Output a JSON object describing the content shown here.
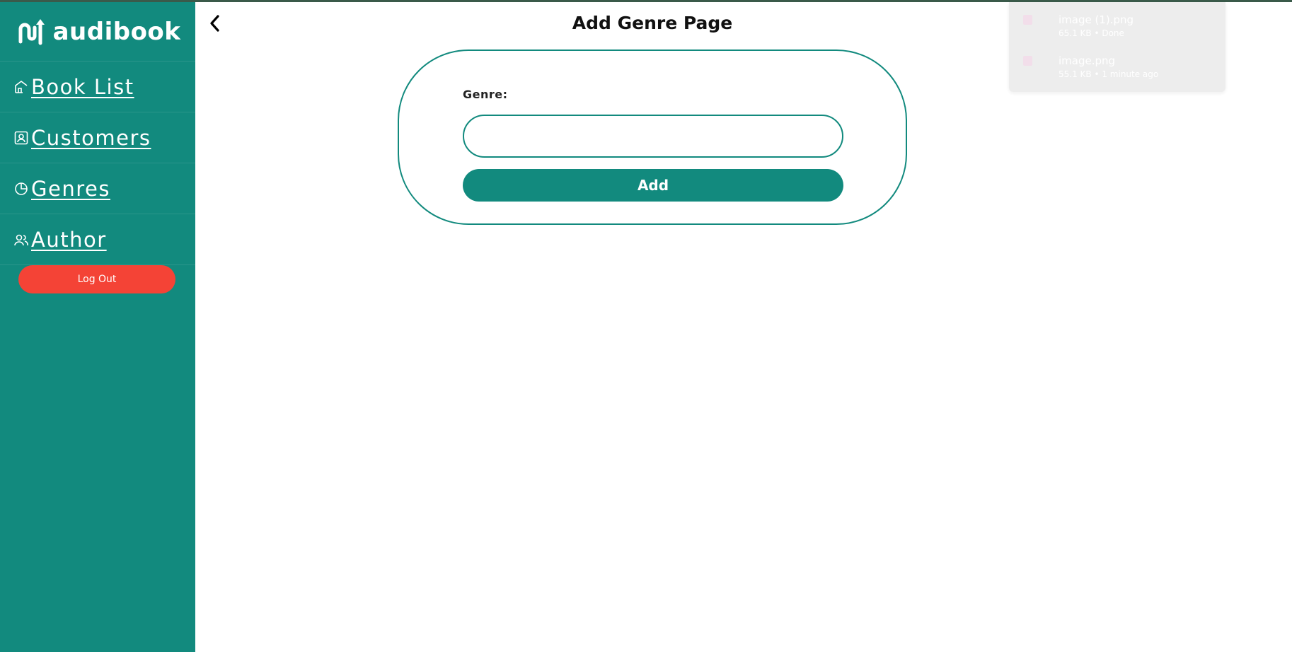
{
  "app": {
    "brand": "audibook"
  },
  "sidebar": {
    "items": [
      {
        "label": "Book List",
        "icon": "home-icon"
      },
      {
        "label": "Customers",
        "icon": "contact-card-icon"
      },
      {
        "label": "Genres",
        "icon": "pie-chart-icon"
      },
      {
        "label": "Author",
        "icon": "users-icon"
      }
    ],
    "logout_label": "Log Out"
  },
  "header": {
    "title": "Add Genre Page",
    "back_icon": "chevron-left-icon"
  },
  "form": {
    "genre_label": "Genre:",
    "genre_value": "",
    "add_label": "Add"
  },
  "downloads": {
    "items": [
      {
        "name": "image (1).png",
        "meta": "65.1 KB • Done"
      },
      {
        "name": "image.png",
        "meta": "55.1 KB • 1 minute ago"
      }
    ]
  },
  "colors": {
    "primary": "#128a7e",
    "danger": "#f44336",
    "text": "#111111"
  }
}
